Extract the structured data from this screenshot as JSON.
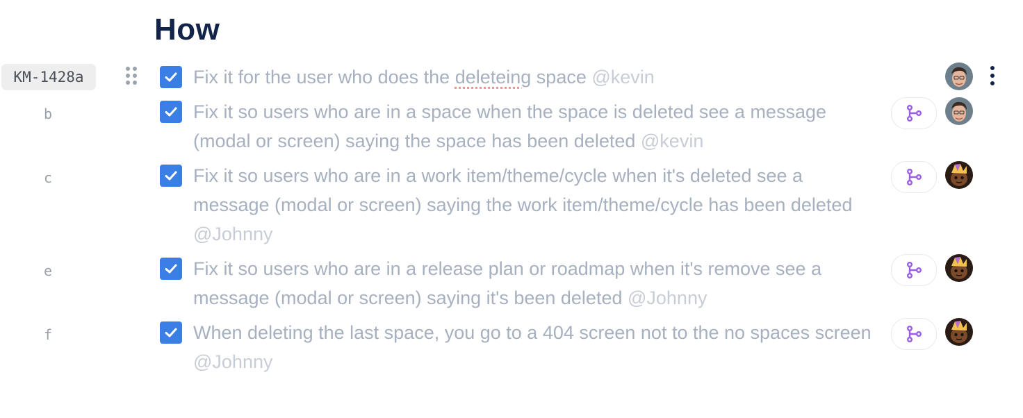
{
  "section": {
    "title": "How"
  },
  "rows": [
    {
      "id": "KM-1428a",
      "text_before": "Fix it for the user who does the ",
      "misspelled": "deleteing",
      "text_after": " space ",
      "mention": "@kevin",
      "checked": true,
      "has_branch": false,
      "avatar": "kevin"
    },
    {
      "id": "b",
      "text": "Fix it so users who are in a space when the space is deleted see a message (modal or screen) saying the space has been deleted ",
      "mention": "@kevin",
      "checked": true,
      "has_branch": true,
      "avatar": "kevin"
    },
    {
      "id": "c",
      "text": "Fix it so users who are in a work item/theme/cycle when it's deleted see a message (modal or screen) saying the work item/theme/cycle has been deleted ",
      "mention": "@Johnny",
      "checked": true,
      "has_branch": true,
      "avatar": "johnny"
    },
    {
      "id": "e",
      "text": "Fix it so users who are in a release plan or roadmap when it's remove see a message (modal or screen) saying it's been deleted ",
      "mention": "@Johnny",
      "checked": true,
      "has_branch": true,
      "avatar": "johnny"
    },
    {
      "id": "f",
      "text": "When deleting the last space, you go to a 404 screen not to the no spaces screen ",
      "mention": "@Johnny",
      "checked": true,
      "has_branch": true,
      "avatar": "johnny"
    }
  ],
  "colors": {
    "checkbox": "#3b7ee6",
    "branch_icon": "#9b5de5",
    "heading": "#13244a",
    "completed_text": "#a7b0bf"
  },
  "icons": {
    "drag": "drag-handle-icon",
    "check": "checkmark-icon",
    "branch": "git-branch-icon",
    "more": "more-vertical-icon"
  }
}
